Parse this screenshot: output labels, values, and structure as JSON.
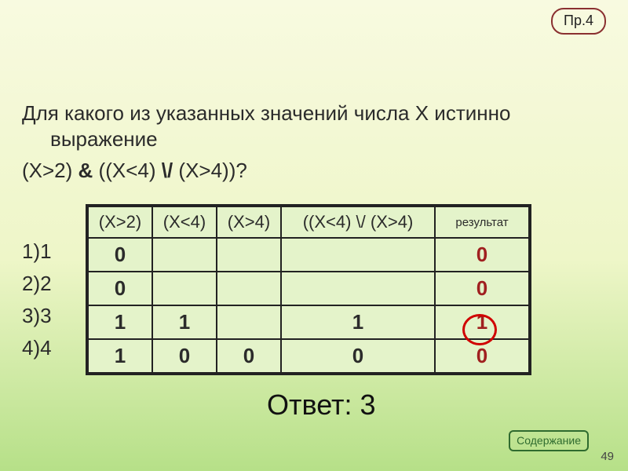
{
  "badge": "Пр.4",
  "question": {
    "line1_prefix": "Для какого из указанных значений числа X истинно",
    "line1_indent": "выражение",
    "expr_parts": [
      "(X>2) ",
      "&",
      " ((X<4) ",
      "\\/",
      " (X>4))?"
    ]
  },
  "options": [
    "1)1",
    "2)2",
    "3)3",
    "4)4"
  ],
  "table": {
    "headers": [
      "(X>2)",
      "(X<4)",
      "(X>4)",
      "((X<4) \\/ (X>4)",
      "результат"
    ],
    "rows": [
      {
        "c1": "0",
        "c2": "",
        "c3": "",
        "c4": "",
        "c5": "0",
        "c5red": true
      },
      {
        "c1": "0",
        "c2": "",
        "c3": "",
        "c4": "",
        "c5": "0",
        "c5red": true
      },
      {
        "c1": "1",
        "c2": "1",
        "c3": "",
        "c4": "1",
        "c5": "1",
        "c5red": true
      },
      {
        "c1": "1",
        "c2": "0",
        "c3": "0",
        "c4": "0",
        "c5": "0",
        "c5red": true
      }
    ]
  },
  "answer_label": "Ответ: 3",
  "toc_label": "Содержание",
  "page_number": "49"
}
